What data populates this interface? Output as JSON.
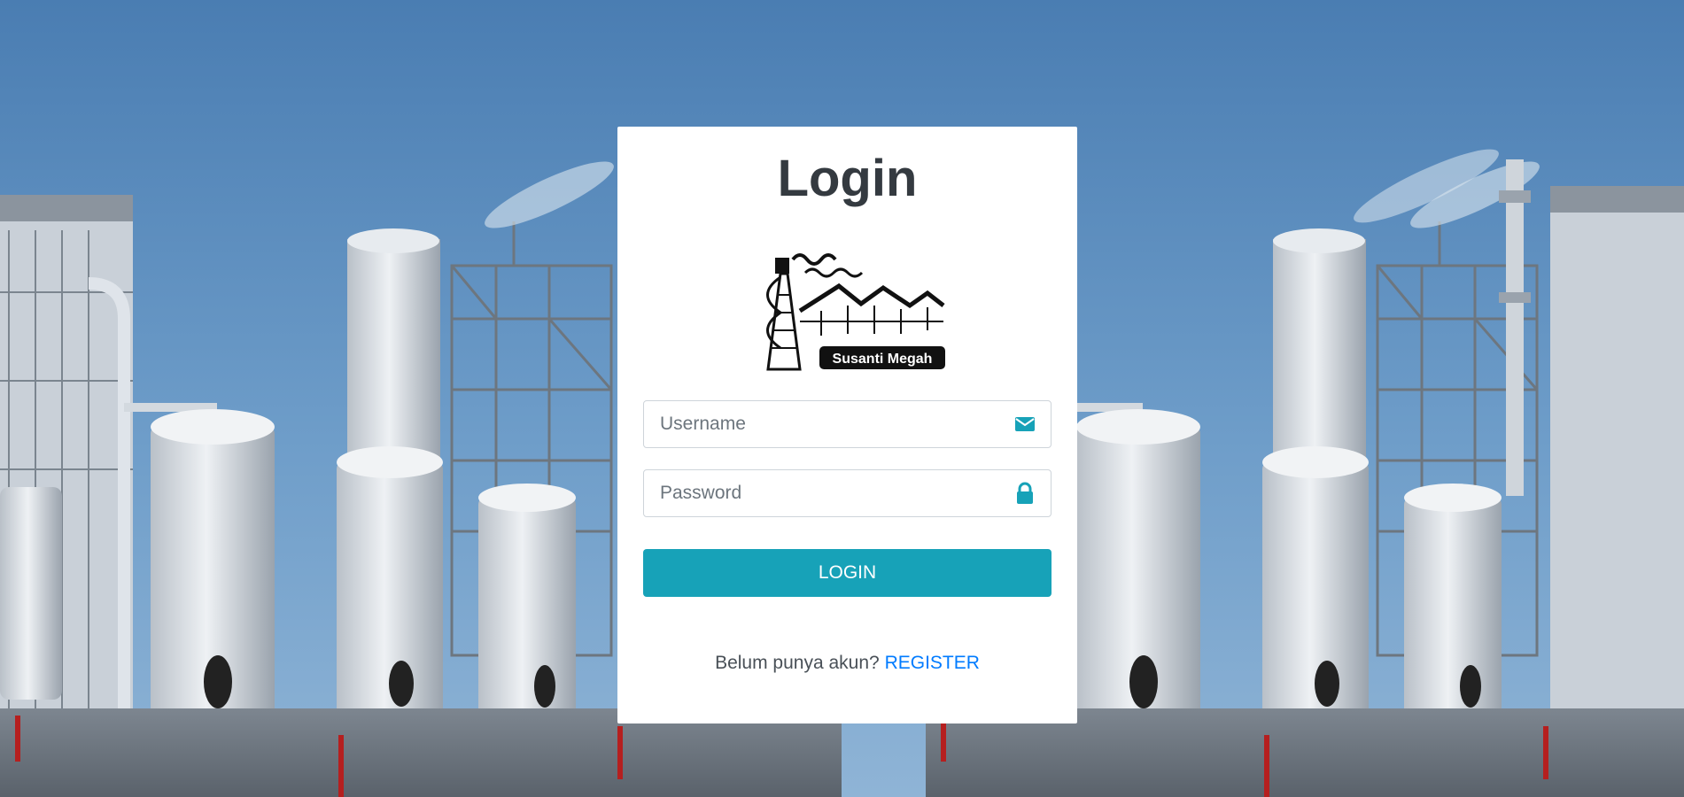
{
  "page": {
    "title": "Login"
  },
  "logo": {
    "text": "Susanti Megah"
  },
  "form": {
    "username_placeholder": "Username",
    "username_value": "",
    "password_placeholder": "Password",
    "password_value": "",
    "login_label": "LOGIN"
  },
  "register": {
    "prompt": "Belum punya akun?",
    "link_label": "REGISTER"
  },
  "icons": {
    "username": "envelope-icon",
    "password": "lock-icon"
  },
  "colors": {
    "accent": "#17a2b8",
    "link": "#007bff",
    "title": "#343a40",
    "sky_top": "#4b7fb3",
    "sky_bottom": "#7ea8cf"
  }
}
